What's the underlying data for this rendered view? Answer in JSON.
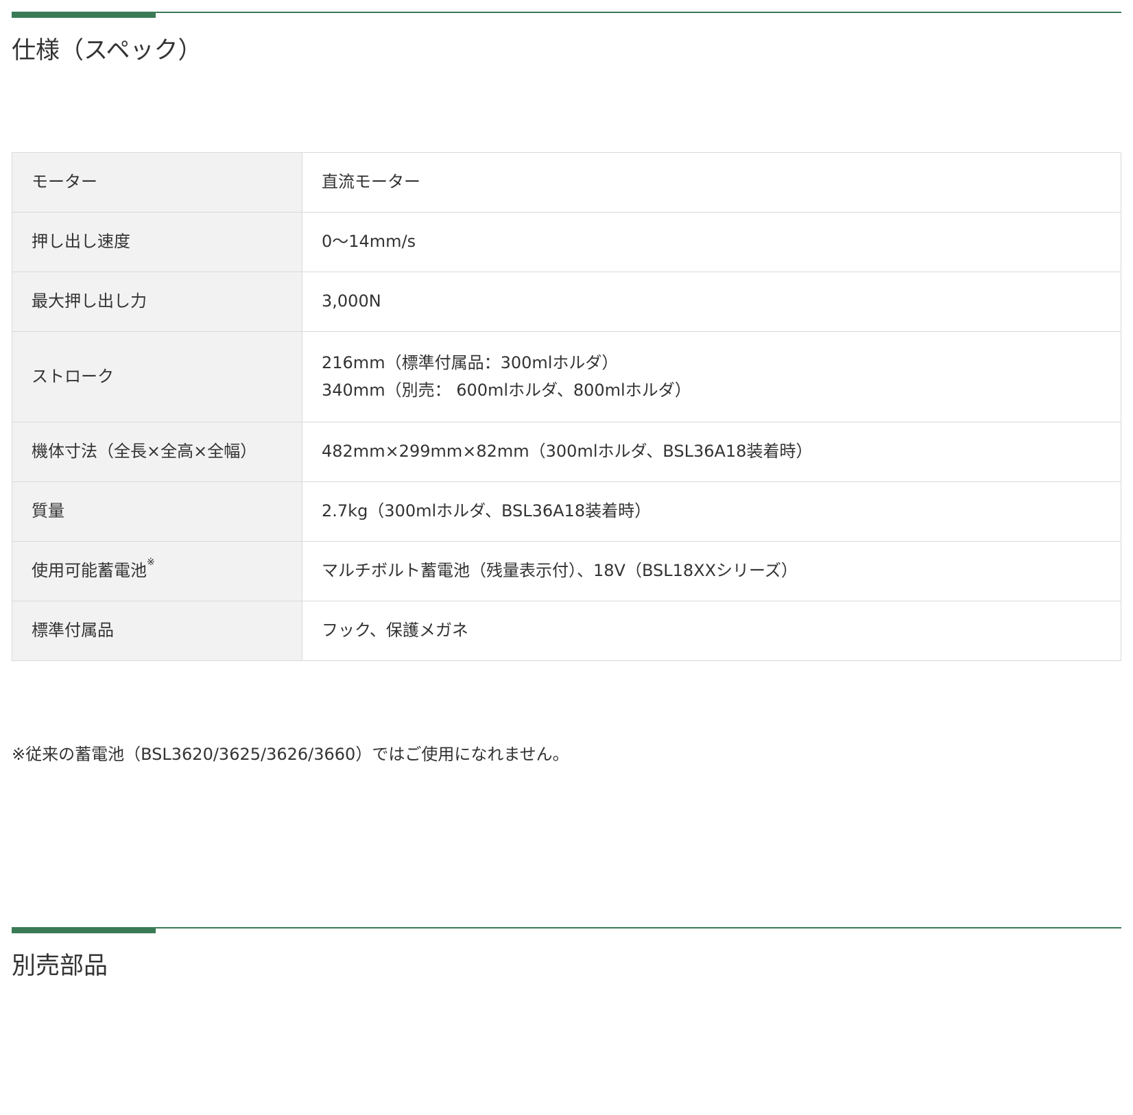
{
  "sections": {
    "spec": {
      "title": "仕様（スペック）"
    },
    "parts": {
      "title": "別売部品"
    }
  },
  "spec_table": {
    "rows": [
      {
        "label": "モーター",
        "values": [
          "直流モーター"
        ]
      },
      {
        "label": "押し出し速度",
        "values": [
          "0〜14mm/s"
        ]
      },
      {
        "label": "最大押し出し力",
        "values": [
          "3,000N"
        ]
      },
      {
        "label": "ストローク",
        "values": [
          "216mm（標準付属品：300mlホルダ）",
          "340mm（別売： 600mlホルダ、800mlホルダ）"
        ]
      },
      {
        "label": "機体寸法（全長×全高×全幅）",
        "values": [
          "482mm×299mm×82mm（300mlホルダ、BSL36A18装着時）"
        ]
      },
      {
        "label": "質量",
        "values": [
          "2.7kg（300mlホルダ、BSL36A18装着時）"
        ]
      },
      {
        "label": "使用可能蓄電池",
        "label_mark": "※",
        "values": [
          "マルチボルト蓄電池（残量表示付）、18V（BSL18XXシリーズ）"
        ]
      },
      {
        "label": "標準付属品",
        "values": [
          "フック、保護メガネ"
        ]
      }
    ]
  },
  "footnote": "※従来の蓄電池（BSL3620/3625/3626/3660）ではご使用になれません。",
  "colors": {
    "accent": "#3a7a55",
    "header_bg": "#f2f2f2",
    "border": "#d9d9d9",
    "text": "#333333"
  }
}
